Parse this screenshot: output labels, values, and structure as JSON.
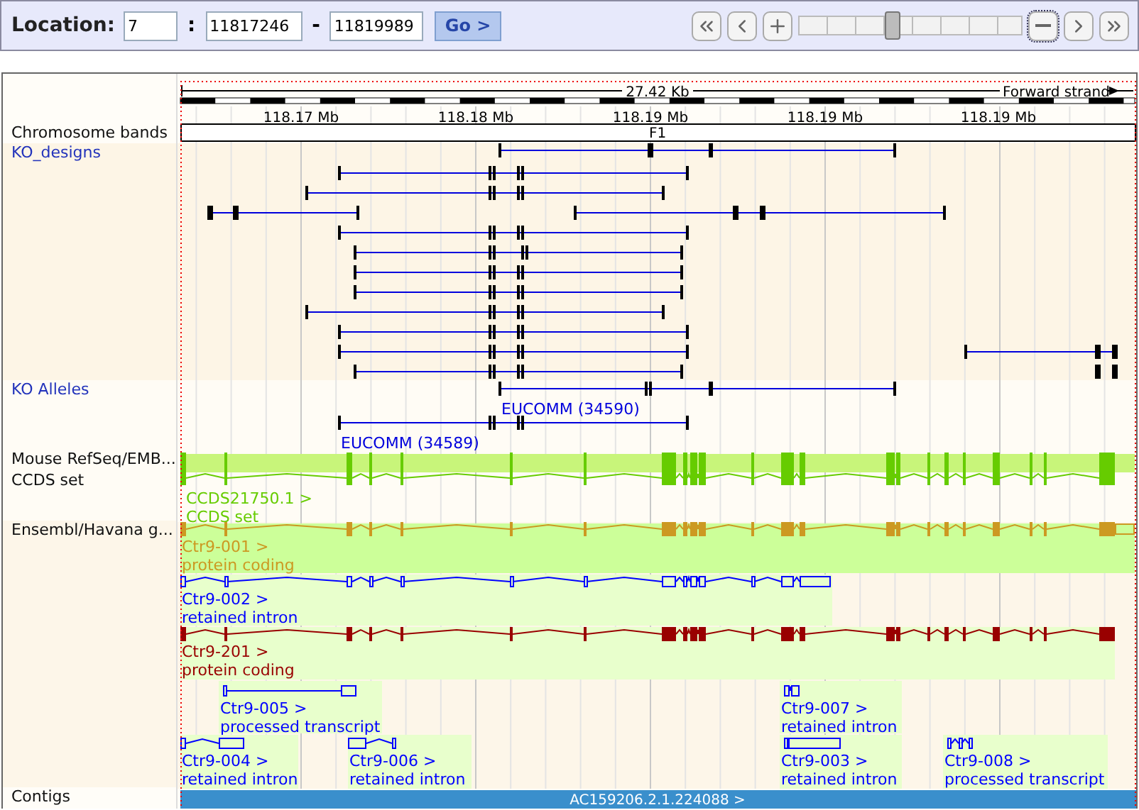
{
  "location": {
    "label": "Location:",
    "chromosome": "7",
    "separator": ":",
    "start": "11817246",
    "dash": "-",
    "end": "11819989",
    "go": "Go >"
  },
  "zoom": {
    "level": 0.42
  },
  "scale": {
    "length": "27.42 Kb",
    "strand": "Forward strand",
    "ticks": [
      "118.17 Mb",
      "118.18 Mb",
      "118.19 Mb",
      "118.19 Mb",
      "118.19 Mb"
    ]
  },
  "tracks": [
    {
      "label": "Chromosome bands",
      "link": false
    },
    {
      "label": "KO_designs",
      "link": true
    },
    {
      "label": "KO Alleles",
      "link": true
    },
    {
      "label": "Mouse RefSeq/EMB...",
      "link": false
    },
    {
      "label": "CCDS set",
      "link": false
    },
    {
      "label": "Ensembl/Havana g...",
      "link": false
    },
    {
      "label": "Contigs",
      "link": false
    }
  ],
  "chromosome_band": "F1",
  "ko_alleles": [
    {
      "label": "EUCOMM (34590)"
    },
    {
      "label": "EUCOMM (34589)"
    }
  ],
  "ccds": {
    "name": "CCDS21750.1 >",
    "type": "CCDS set"
  },
  "transcripts": [
    {
      "name": "Ctr9-001 >",
      "biotype": "protein coding",
      "color": "#cc9922",
      "kind": "coding",
      "highlighted": true
    },
    {
      "name": "Ctr9-002 >",
      "biotype": "retained intron",
      "color": "#0000ff",
      "kind": "noncoding",
      "highlighted": false
    },
    {
      "name": "Ctr9-201 >",
      "biotype": "protein coding",
      "color": "#990000",
      "kind": "coding",
      "highlighted": false
    },
    {
      "name": "Ctr9-005 >",
      "biotype": "processed transcript",
      "color": "#0000ff",
      "kind": "noncoding",
      "highlighted": false
    },
    {
      "name": "Ctr9-007 >",
      "biotype": "retained intron",
      "color": "#0000ff",
      "kind": "noncoding",
      "highlighted": false
    },
    {
      "name": "Ctr9-004 >",
      "biotype": "retained intron",
      "color": "#0000ff",
      "kind": "noncoding",
      "highlighted": false
    },
    {
      "name": "Ctr9-006 >",
      "biotype": "retained intron",
      "color": "#0000ff",
      "kind": "noncoding",
      "highlighted": false
    },
    {
      "name": "Ctr9-003 >",
      "biotype": "retained intron",
      "color": "#0000ff",
      "kind": "noncoding",
      "highlighted": false
    },
    {
      "name": "Ctr9-008 >",
      "biotype": "processed transcript",
      "color": "#0000ff",
      "kind": "noncoding",
      "highlighted": false
    }
  ],
  "contig": "AC159206.2.1.224088 >"
}
